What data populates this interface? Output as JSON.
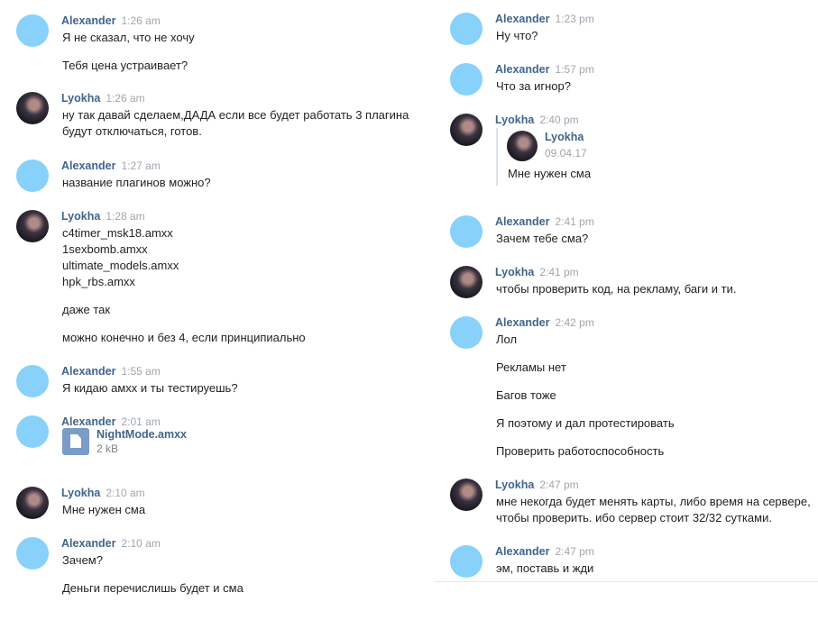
{
  "left_messages": [
    {
      "author": "Alexander",
      "time": "1:26 am",
      "avatar": "blue",
      "lines": [
        "Я не сказал, что не хочу",
        "",
        "Тебя цена устраивает?"
      ]
    },
    {
      "author": "Lyokha",
      "time": "1:26 am",
      "avatar": "photo",
      "lines": [
        "ну так давай сделаем,ДАДА если все будет работать 3 плагина",
        "будут отключаться, готов."
      ]
    },
    {
      "author": "Alexander",
      "time": "1:27 am",
      "avatar": "blue",
      "lines": [
        "название плагинов можно?"
      ]
    },
    {
      "author": "Lyokha",
      "time": "1:28 am",
      "avatar": "photo",
      "lines": [
        "c4timer_msk18.amxx",
        "1sexbomb.amxx",
        "ultimate_models.amxx",
        "hpk_rbs.amxx",
        "",
        "даже так",
        "",
        "можно конечно и без 4, если принципиально"
      ]
    },
    {
      "author": "Alexander",
      "time": "1:55 am",
      "avatar": "blue",
      "lines": [
        "Я кидаю амхх и ты тестируешь?"
      ]
    },
    {
      "author": "Alexander",
      "time": "2:01 am",
      "avatar": "blue",
      "attachment": {
        "name": "NightMode.amxx",
        "size": "2 kB",
        "icon": "file-icon"
      }
    },
    {
      "author": "Lyokha",
      "time": "2:10 am",
      "avatar": "photo",
      "lines": [
        "Мне нужен сма"
      ]
    },
    {
      "author": "Alexander",
      "time": "2:10 am",
      "avatar": "blue",
      "lines": [
        "Зачем?",
        "",
        "Деньги перечислишь будет и сма"
      ]
    }
  ],
  "right_messages": [
    {
      "author": "Alexander",
      "time": "1:23 pm",
      "avatar": "blue",
      "lines": [
        "Ну что?"
      ]
    },
    {
      "author": "Alexander",
      "time": "1:57 pm",
      "avatar": "blue",
      "lines": [
        "Что за игнор?"
      ]
    },
    {
      "author": "Lyokha",
      "time": "2:40 pm",
      "avatar": "photo",
      "forwarded": {
        "author": "Lyokha",
        "date": "09.04.17",
        "text": "Мне нужен сма"
      }
    },
    {
      "author": "Alexander",
      "time": "2:41 pm",
      "avatar": "blue",
      "lines": [
        "Зачем тебе сма?"
      ]
    },
    {
      "author": "Lyokha",
      "time": "2:41 pm",
      "avatar": "photo",
      "lines": [
        "чтобы проверить код, на рекламу, баги и ти."
      ]
    },
    {
      "author": "Alexander",
      "time": "2:42 pm",
      "avatar": "blue",
      "lines": [
        "Лол",
        "",
        "Рекламы нет",
        "",
        "Багов тоже",
        "",
        "Я поэтому и дал протестировать",
        "",
        "Проверить работоспособность"
      ]
    },
    {
      "author": "Lyokha",
      "time": "2:47 pm",
      "avatar": "photo",
      "lines": [
        "мне некогда будет менять карты, либо время на сервере,",
        "чтобы проверить. ибо сервер стоит 32/32 сутками."
      ]
    },
    {
      "author": "Alexander",
      "time": "2:47 pm",
      "avatar": "blue",
      "lines": [
        "эм, поставь и жди"
      ]
    }
  ]
}
